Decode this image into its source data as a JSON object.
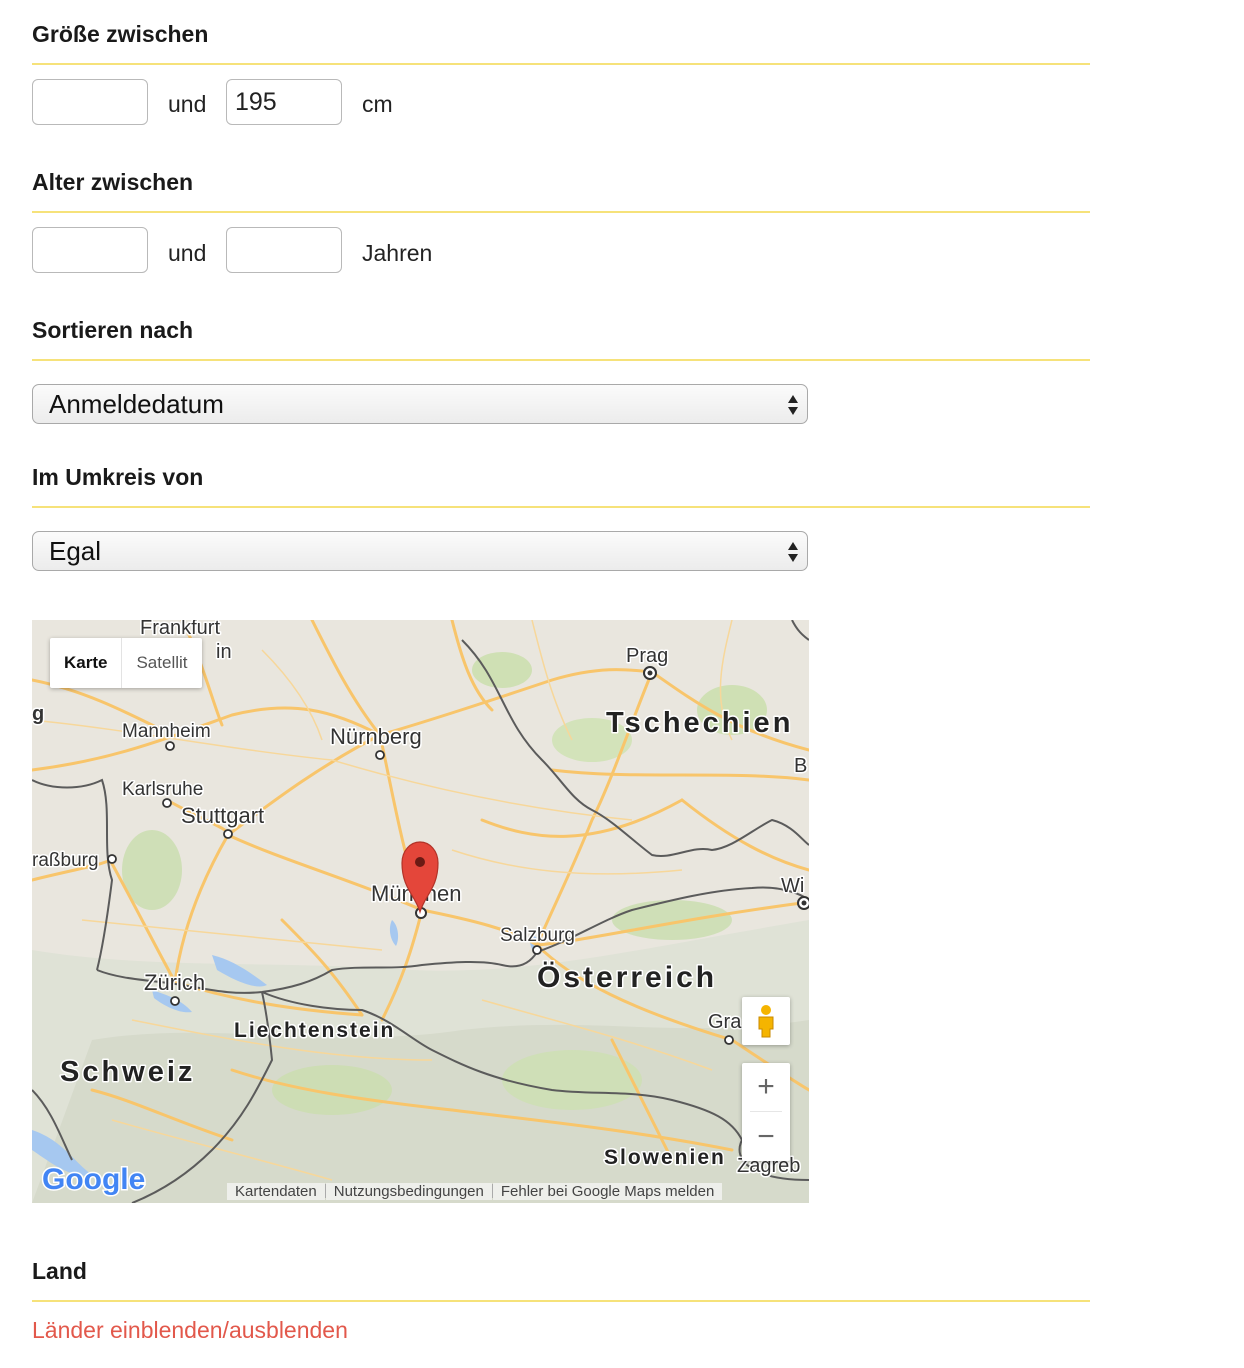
{
  "height_filter": {
    "title": "Größe zwischen",
    "min_value": "",
    "max_value": "195",
    "connector": "und",
    "unit": "cm"
  },
  "age_filter": {
    "title": "Alter zwischen",
    "min_value": "",
    "max_value": "",
    "connector": "und",
    "unit": "Jahren"
  },
  "sort": {
    "title": "Sortieren nach",
    "selected": "Anmeldedatum"
  },
  "radius": {
    "title": "Im Umkreis von",
    "selected": "Egal"
  },
  "map": {
    "type_buttons": {
      "map": "Karte",
      "satellite": "Satellit"
    },
    "labels": {
      "frankfurt": "Frankfurt",
      "mainz_fragment": "in",
      "edge_g": "g",
      "prag": "Prag",
      "tschechien": "Tschechien",
      "edge_b": "B",
      "mannheim": "Mannheim",
      "nuernberg": "Nürnberg",
      "karlsruhe": "Karlsruhe",
      "stuttgart": "Stuttgart",
      "strassburg": "raßburg",
      "muenchen": "München",
      "wien": "Wi",
      "salzburg": "Salzburg",
      "oesterreich": "Österreich",
      "zuerich": "Zürich",
      "liechtenstein": "Liechtenstein",
      "graz": "Gra",
      "schweiz": "Schweiz",
      "slowenien": "Slowenien",
      "zagreb": "Zagreb"
    },
    "zoom_in": "+",
    "zoom_out": "−",
    "logo": "Google",
    "footer": {
      "data": "Kartendaten",
      "terms": "Nutzungsbedingungen",
      "report": "Fehler bei Google Maps melden"
    },
    "colors": {
      "road": "#f8c56b",
      "border": "#5b5b5b",
      "water": "#a6c8f0",
      "marker": "#e4463a"
    }
  },
  "country": {
    "title": "Land",
    "toggle_link": "Länder einblenden/ausblenden"
  },
  "colors": {
    "rule": "#f6e27a",
    "link": "#e2584b"
  }
}
